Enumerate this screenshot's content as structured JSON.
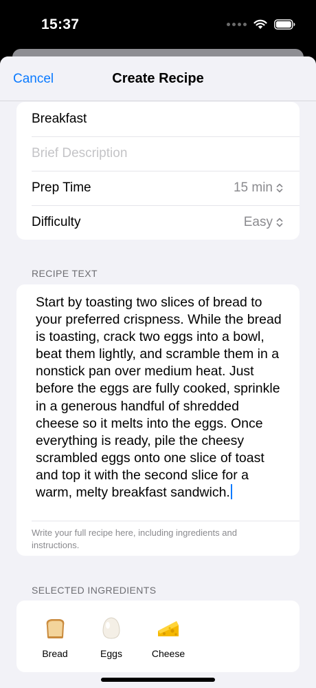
{
  "status_bar": {
    "time": "15:37"
  },
  "nav": {
    "cancel_label": "Cancel",
    "title": "Create Recipe"
  },
  "form": {
    "name_value": "Breakfast",
    "description_placeholder": "Brief Description",
    "prep_time": {
      "label": "Prep Time",
      "value": "15 min"
    },
    "difficulty": {
      "label": "Difficulty",
      "value": "Easy"
    }
  },
  "recipe_text": {
    "header": "RECIPE TEXT",
    "body": "Start by toasting two slices of bread to your preferred crispness. While the bread is toasting, crack two eggs into a bowl, beat them lightly, and scramble them in a nonstick pan over medium heat. Just before the eggs are fully cooked, sprinkle in a generous handful of shredded cheese so it melts into the eggs. Once everything is ready, pile the cheesy scrambled eggs onto one slice of toast and top it with the second slice for a warm, melty breakfast sandwich.",
    "footnote": "Write your full recipe here, including ingredients and instructions."
  },
  "ingredients": {
    "header": "SELECTED INGREDIENTS",
    "items": [
      {
        "label": "Bread",
        "icon": "bread-icon"
      },
      {
        "label": "Eggs",
        "icon": "egg-icon"
      },
      {
        "label": "Cheese",
        "icon": "cheese-icon"
      }
    ]
  },
  "colors": {
    "accent": "#0a7aff",
    "background": "#f2f2f7",
    "card": "#ffffff",
    "secondary_text": "#8a8a8e"
  }
}
